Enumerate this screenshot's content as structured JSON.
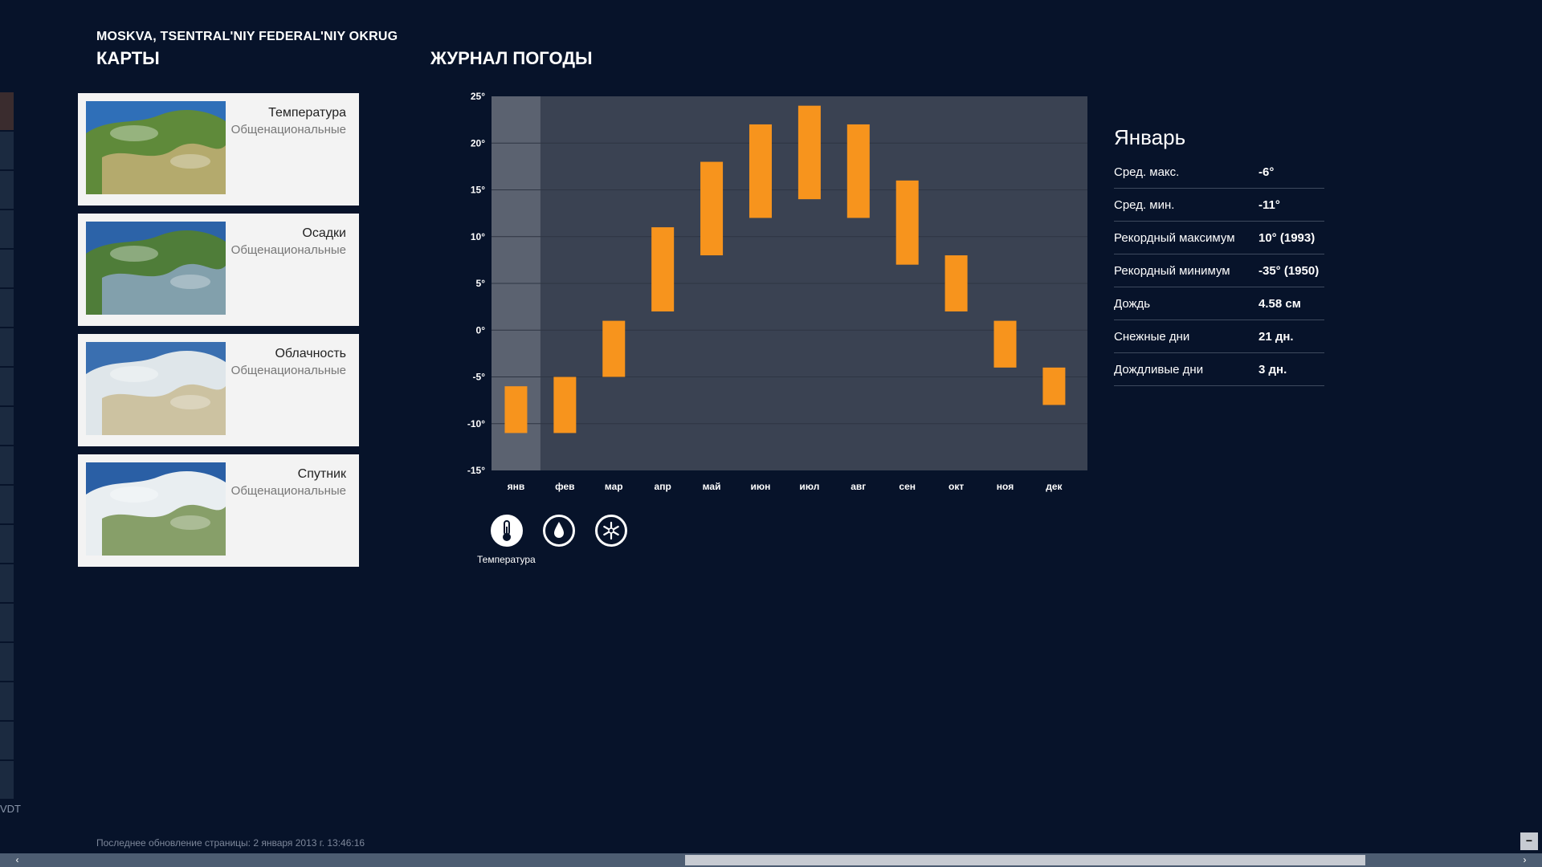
{
  "header": {
    "location": "MOSKVA, TSENTRAL'NIY FEDERAL'NIY OKRUG",
    "maps_title": "КАРТЫ",
    "log_title": "ЖУРНАЛ ПОГОДЫ"
  },
  "edge_text": "VDT",
  "maps": [
    {
      "title": "Температура",
      "subtitle": "Общенациональные",
      "thumb_icon": "temperature-map-thumbnail"
    },
    {
      "title": "Осадки",
      "subtitle": "Общенациональные",
      "thumb_icon": "precipitation-map-thumbnail"
    },
    {
      "title": "Облачность",
      "subtitle": "Общенациональные",
      "thumb_icon": "cloud-map-thumbnail"
    },
    {
      "title": "Спутник",
      "subtitle": "Общенациональные",
      "thumb_icon": "satellite-map-thumbnail"
    }
  ],
  "chart_data": {
    "type": "bar",
    "subtype": "range",
    "categories": [
      "янв",
      "фев",
      "мар",
      "апр",
      "май",
      "июн",
      "июл",
      "авг",
      "сен",
      "окт",
      "ноя",
      "дек"
    ],
    "series": [
      {
        "low": [
          -11,
          -11,
          -5,
          2,
          8,
          12,
          14,
          12,
          7,
          2,
          -4,
          -8
        ],
        "high": [
          -6,
          -5,
          1,
          11,
          18,
          22,
          24,
          22,
          16,
          8,
          1,
          -4
        ]
      }
    ],
    "ylim": [
      -15,
      25
    ],
    "yticks": [
      25,
      20,
      15,
      10,
      5,
      0,
      -5,
      -10,
      -15
    ],
    "ytick_labels": [
      "25°",
      "20°",
      "15°",
      "10°",
      "5°",
      "0°",
      "-5°",
      "-10°",
      "-15°"
    ],
    "selected_index": 0,
    "grid": true,
    "colors": {
      "bar": "#f7941d",
      "plot_bg": "#3a4252",
      "selected_bg": "#5b6270",
      "grid": "#2e3543"
    }
  },
  "view_toggle": {
    "buttons": [
      "thermometer-icon",
      "raindrop-icon",
      "snowflake-icon"
    ],
    "active": 0,
    "active_label": "Температура"
  },
  "month": {
    "name": "Январь",
    "stats": [
      {
        "label": "Сред. макс.",
        "value": "-6°"
      },
      {
        "label": "Сред. мин.",
        "value": "-11°"
      },
      {
        "label": "Рекордный максимум",
        "value": "10° (1993)"
      },
      {
        "label": "Рекордный минимум",
        "value": "-35° (1950)"
      },
      {
        "label": "Дождь",
        "value": "4.58 см"
      },
      {
        "label": "Снежные дни",
        "value": "21 дн."
      },
      {
        "label": "Дождливые дни",
        "value": "3 дн."
      }
    ]
  },
  "footer": {
    "last_updated": "Последнее обновление страницы: 2 января 2013 г. 13:46:16",
    "zoom_symbol": "−"
  },
  "scrollbar": {
    "left_arrow": "‹",
    "right_arrow": "›"
  },
  "colors": {
    "background": "#07132a",
    "accent": "#f7941d",
    "card_bg": "#f3f3f3"
  }
}
